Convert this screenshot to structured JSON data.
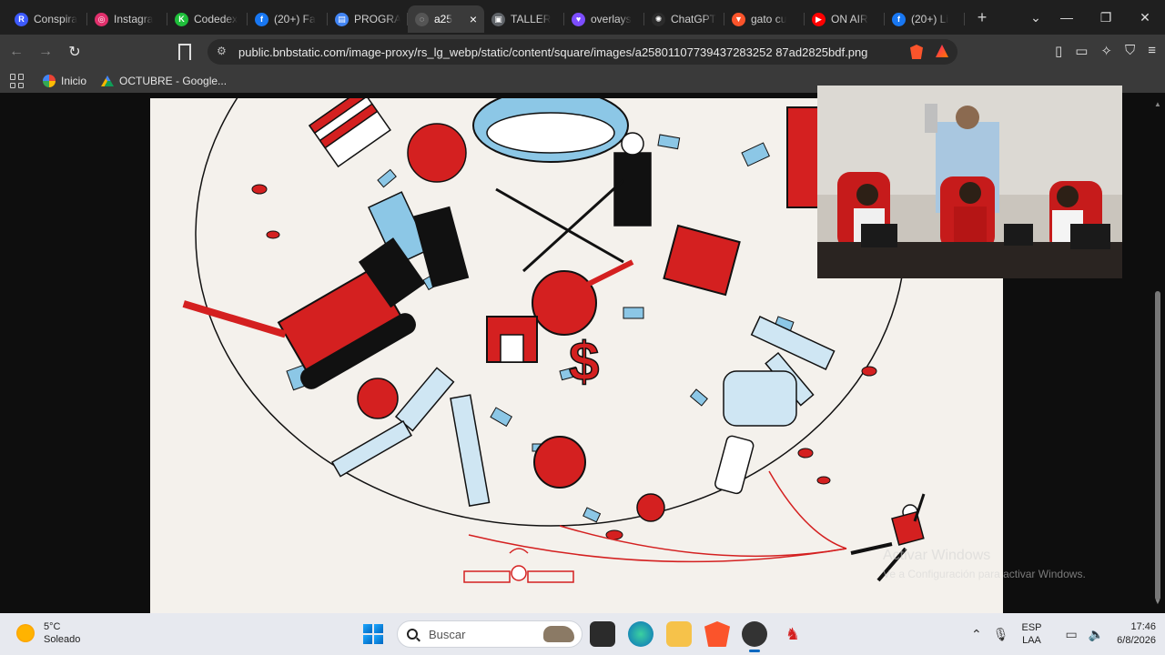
{
  "tabs": [
    {
      "label": "Conspira",
      "icon": "r-icon",
      "color": "#3d5afe",
      "glyph": "R"
    },
    {
      "label": "Instagra",
      "icon": "instagram-icon",
      "color": "#e1306c",
      "glyph": "◎"
    },
    {
      "label": "Codedex",
      "icon": "codedex-icon",
      "color": "#1fbf3b",
      "glyph": "K"
    },
    {
      "label": "(20+) Fa",
      "icon": "facebook-icon",
      "color": "#1877f2",
      "glyph": "f"
    },
    {
      "label": "PROGRA",
      "icon": "docs-icon",
      "color": "#4285f4",
      "glyph": "▤"
    },
    {
      "label": "a25",
      "icon": "globe-icon",
      "color": "#555555",
      "glyph": "◌",
      "active": true
    },
    {
      "label": "TALLER",
      "icon": "slides-icon",
      "color": "#5f6368",
      "glyph": "▣"
    },
    {
      "label": "overlays",
      "icon": "heart-icon",
      "color": "#7c4dff",
      "glyph": "♥"
    },
    {
      "label": "ChatGPT",
      "icon": "chatgpt-icon",
      "color": "#2b2b2b",
      "glyph": "✺"
    },
    {
      "label": "gato cu",
      "icon": "brave-icon",
      "color": "#fb542b",
      "glyph": "▼"
    },
    {
      "label": "ON AIR",
      "icon": "youtube-icon",
      "color": "#ff0000",
      "glyph": "▶"
    },
    {
      "label": "(20+) Li",
      "icon": "facebook-icon",
      "color": "#1877f2",
      "glyph": "f"
    }
  ],
  "tab_close": "×",
  "new_tab": "+",
  "window_controls": {
    "menu": "⌄",
    "minimize": "—",
    "restore": "❐",
    "close": "✕"
  },
  "nav": {
    "back": "←",
    "forward": "→",
    "reload": "↻"
  },
  "address_bar": {
    "url": "public.bnbstatic.com/image-proxy/rs_lg_webp/static/content/square/images/a25801107739437283252 87ad2825bdf.png"
  },
  "bookmarks": [
    {
      "label": "Inicio",
      "icon": "google-icon"
    },
    {
      "label": "OCTUBRE - Google...",
      "icon": "drive-icon"
    }
  ],
  "watermark": {
    "line1": "Activar Windows",
    "line2": "Ve a Configuración para activar Windows."
  },
  "taskbar": {
    "weather_temp": "5°C",
    "weather_desc": "Soleado",
    "search_placeholder": "Buscar",
    "lang_1": "ESP",
    "lang_2": "LAA",
    "time": "17:46",
    "date": "6/8/2026"
  },
  "colors": {
    "accent_red": "#d42020",
    "accent_blue": "#5aa9d6",
    "ink": "#111111",
    "paper": "#f4f1ec"
  }
}
